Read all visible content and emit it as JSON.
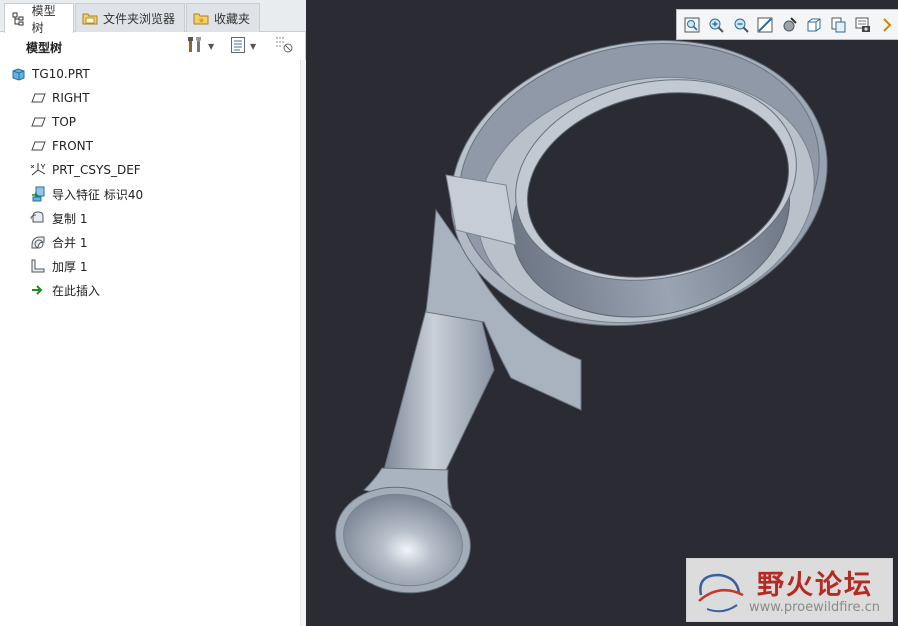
{
  "tabs": [
    {
      "label": "模型树",
      "icon": "model-tree-tab-icon"
    },
    {
      "label": "文件夹浏览器",
      "icon": "folder-browser-icon"
    },
    {
      "label": "收藏夹",
      "icon": "favorites-icon"
    }
  ],
  "panel": {
    "title": "模型树",
    "toolbar": [
      "settings-tools-icon",
      "show-options-icon",
      "filter-icon"
    ]
  },
  "tree": {
    "root": {
      "label": "TG10.PRT",
      "icon": "part-icon"
    },
    "items": [
      {
        "label": "RIGHT",
        "icon": "datum-plane-icon"
      },
      {
        "label": "TOP",
        "icon": "datum-plane-icon"
      },
      {
        "label": "FRONT",
        "icon": "datum-plane-icon"
      },
      {
        "label": "PRT_CSYS_DEF",
        "icon": "coordinate-system-icon"
      },
      {
        "label": "导入特征 标识40",
        "icon": "import-feature-icon"
      },
      {
        "label": "复制 1",
        "icon": "copy-feature-icon"
      },
      {
        "label": "合并 1",
        "icon": "merge-feature-icon"
      },
      {
        "label": "加厚 1",
        "icon": "thicken-feature-icon"
      },
      {
        "label": "在此插入",
        "icon": "insert-here-arrow-icon",
        "accent": "#1f8a2a"
      }
    ]
  },
  "view_toolbar": [
    "refit-icon",
    "zoom-in-icon",
    "zoom-out-icon",
    "repaint-icon",
    "display-style-icon",
    "saved-orientations-icon",
    "view-manager-icon",
    "datum-display-icon",
    "more-icon"
  ],
  "watermark": {
    "title": "野火论坛",
    "url": "www.proewildfire.cn",
    "title_color": "#b52a22"
  },
  "colors": {
    "viewport_bg": "#2b2b33",
    "model_fill": "#a7b0bd",
    "model_dark": "#6e7786",
    "model_light": "#dde2e8"
  }
}
